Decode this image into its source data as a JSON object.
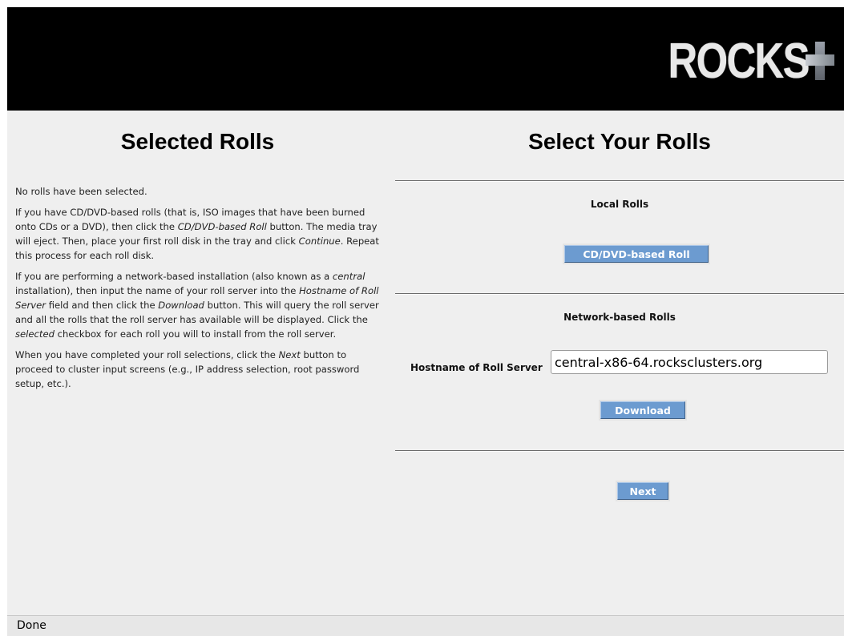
{
  "header": {
    "logo_text": "ROCKS",
    "logo_icon": "plus-icon"
  },
  "left": {
    "title": "Selected Rolls",
    "p1": "No rolls have been selected.",
    "p2": {
      "a": "If you have CD/DVD-based rolls (that is, ISO images that have been burned onto CDs or a DVD), then click the ",
      "b": "CD/DVD-based Roll",
      "c": " button. The media tray will eject. Then, place your first roll disk in the tray and click ",
      "d": "Continue",
      "e": ". Repeat this process for each roll disk."
    },
    "p3": {
      "a": "If you are performing a network-based installation (also known as a ",
      "b": "central",
      "c": " installation), then input the name of your roll server into the ",
      "d": "Hostname of Roll Server",
      "e": " field and then click the ",
      "f": "Download",
      "g": " button. This will query the roll server and all the rolls that the roll server has available will be displayed. Click the ",
      "h": "selected",
      "i": " checkbox for each roll you will to install from the roll server."
    },
    "p4": {
      "a": "When you have completed your roll selections, click the ",
      "b": "Next",
      "c": " button to proceed to cluster input screens (e.g., IP address selection, root password setup, etc.)."
    }
  },
  "right": {
    "title": "Select Your Rolls",
    "local_label": "Local Rolls",
    "cd_button": "CD/DVD-based Roll",
    "network_label": "Network-based Rolls",
    "hostname_label": "Hostname of Roll Server",
    "hostname_value": "central-x86-64.rocksclusters.org",
    "download_button": "Download",
    "next_button": "Next"
  },
  "status": {
    "text": "Done"
  },
  "colors": {
    "button_bg": "#6c9bd0",
    "header_bg": "#000000",
    "page_bg": "#efefef"
  }
}
